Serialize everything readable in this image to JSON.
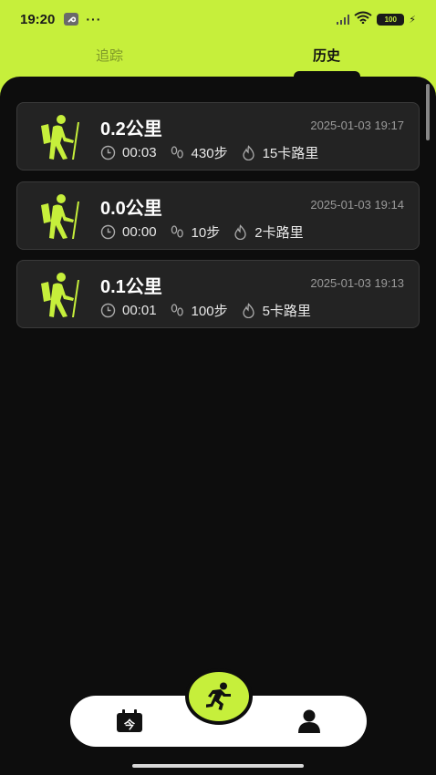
{
  "status_bar": {
    "time": "19:20",
    "more": "···",
    "battery": "100",
    "icons": [
      "wrench-icon",
      "signal-icon",
      "wifi-icon",
      "battery-icon",
      "charging-icon"
    ]
  },
  "tabs": [
    {
      "label": "追踪",
      "active": false
    },
    {
      "label": "历史",
      "active": true
    }
  ],
  "records": [
    {
      "distance": "0.2公里",
      "datetime": "2025-01-03 19:17",
      "duration": "00:03",
      "steps": "430步",
      "calories": "15卡路里"
    },
    {
      "distance": "0.0公里",
      "datetime": "2025-01-03 19:14",
      "duration": "00:00",
      "steps": "10步",
      "calories": "2卡路里"
    },
    {
      "distance": "0.1公里",
      "datetime": "2025-01-03 19:13",
      "duration": "00:01",
      "steps": "100步",
      "calories": "5卡路里"
    }
  ],
  "bottom_nav": {
    "left": "今",
    "icons": [
      "calendar-today-icon",
      "running-person-icon",
      "profile-icon"
    ]
  },
  "colors": {
    "accent": "#c6ef3b",
    "background": "#0d0d0d",
    "card": "#232323",
    "muted_text": "#9a9a9a"
  }
}
